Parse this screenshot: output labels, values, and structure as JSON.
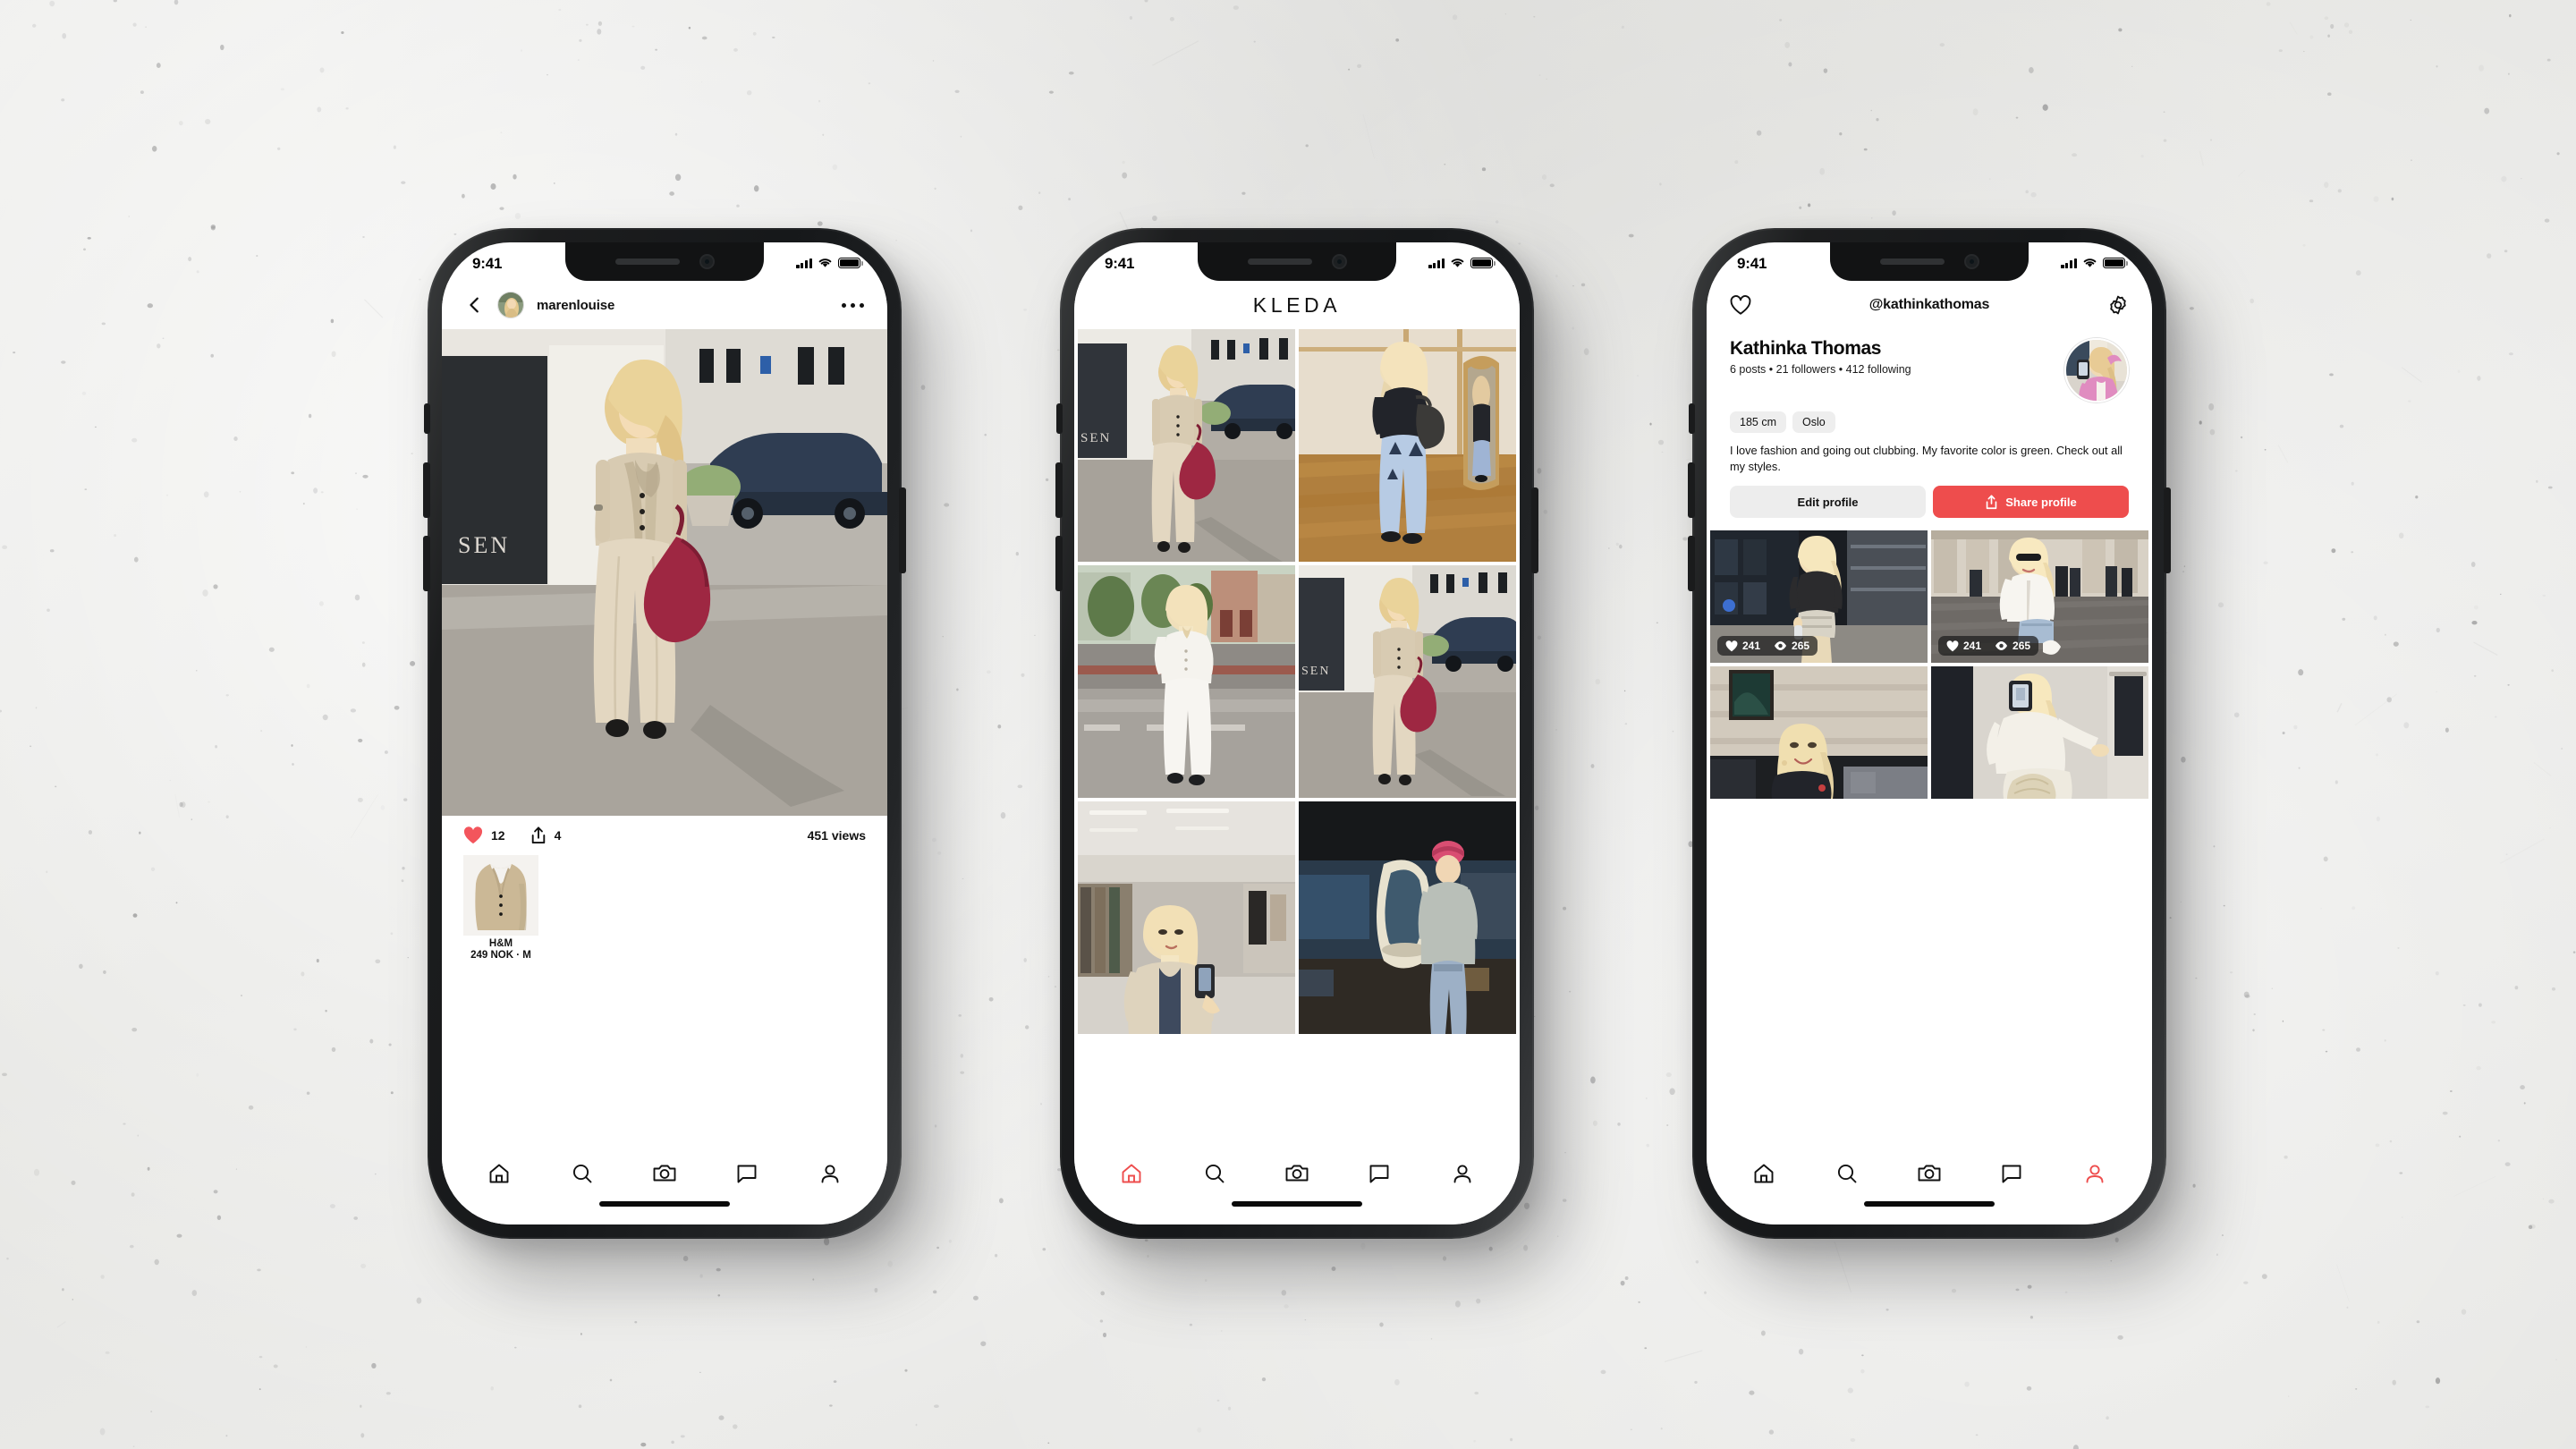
{
  "background": {
    "color": "#e9e9e7",
    "style": "concrete-texture"
  },
  "theme": {
    "accent": "#ee4d4d",
    "chip_bg": "#eeeeee",
    "text": "#111111"
  },
  "status_bar": {
    "time": "9:41",
    "signal_icon": "cellular-signal-icon",
    "wifi_icon": "wifi-icon",
    "battery_icon": "battery-full-icon"
  },
  "phone1": {
    "name": "post-detail-screen",
    "topbar": {
      "back_icon": "back-chevron-icon",
      "avatar": "user-avatar",
      "username": "marenlouise",
      "more_icon": "more-options-icon"
    },
    "post": {
      "photo_alt": "woman-in-beige-vest-and-trousers-on-street",
      "likes_icon": "heart-filled-icon",
      "likes": "12",
      "share_icon": "share-icon",
      "shares": "4",
      "views": "451 views"
    },
    "product": {
      "thumb_alt": "beige-waistcoat-product-photo",
      "brand": "H&M",
      "price": "249 NOK · M"
    },
    "tabs": [
      {
        "name": "home-tab",
        "icon": "home-icon",
        "active": false
      },
      {
        "name": "search-tab",
        "icon": "search-icon",
        "active": false
      },
      {
        "name": "camera-tab",
        "icon": "camera-icon",
        "active": false
      },
      {
        "name": "messages-tab",
        "icon": "chat-bubble-icon",
        "active": false
      },
      {
        "name": "profile-tab",
        "icon": "person-icon",
        "active": false
      }
    ]
  },
  "phone2": {
    "name": "feed-screen",
    "topbar": {
      "title": "KLEDA"
    },
    "grid": [
      {
        "alt": "woman-beige-vest-street-walking"
      },
      {
        "alt": "woman-back-view-jeans-mirror"
      },
      {
        "alt": "woman-white-suit-crosswalk"
      },
      {
        "alt": "woman-beige-vest-red-bag-street"
      },
      {
        "alt": "woman-fur-coat-store-mirror-selfie"
      },
      {
        "alt": "man-grey-tshirt-workshop"
      }
    ],
    "tabs": [
      {
        "name": "home-tab",
        "icon": "home-icon",
        "active": true
      },
      {
        "name": "search-tab",
        "icon": "search-icon",
        "active": false
      },
      {
        "name": "camera-tab",
        "icon": "camera-icon",
        "active": false
      },
      {
        "name": "messages-tab",
        "icon": "chat-bubble-icon",
        "active": false
      },
      {
        "name": "profile-tab",
        "icon": "person-icon",
        "active": false
      }
    ]
  },
  "phone3": {
    "name": "profile-screen",
    "topbar": {
      "likes_icon": "heart-outline-icon",
      "handle": "@kathinkathomas",
      "settings_icon": "gear-icon"
    },
    "profile": {
      "display_name": "Kathinka Thomas",
      "stats": "6 posts • 21 followers • 412 following",
      "avatar_alt": "profile-avatar-mirror-selfie",
      "chips": [
        "185 cm",
        "Oslo"
      ],
      "bio": "I love fashion and going out clubbing. My favorite color is green. Check out all my styles.",
      "edit_button": "Edit profile",
      "share_button": "Share profile",
      "share_icon": "share-icon"
    },
    "grid": [
      {
        "alt": "woman-black-top-sequin-skirt-night",
        "likes_icon": "heart-filled-icon",
        "likes": "241",
        "views_icon": "eye-icon",
        "views": "265"
      },
      {
        "alt": "woman-white-top-denim-shorts-colonnade",
        "likes_icon": "heart-filled-icon",
        "likes": "241",
        "views_icon": "eye-icon",
        "views": "265"
      },
      {
        "alt": "woman-smiling-indoor-selfie"
      },
      {
        "alt": "woman-white-fluffy-sweater-mirror-selfie"
      }
    ],
    "tabs": [
      {
        "name": "home-tab",
        "icon": "home-icon",
        "active": false
      },
      {
        "name": "search-tab",
        "icon": "search-icon",
        "active": false
      },
      {
        "name": "camera-tab",
        "icon": "camera-icon",
        "active": false
      },
      {
        "name": "messages-tab",
        "icon": "chat-bubble-icon",
        "active": false
      },
      {
        "name": "profile-tab",
        "icon": "person-icon",
        "active": true
      }
    ]
  }
}
